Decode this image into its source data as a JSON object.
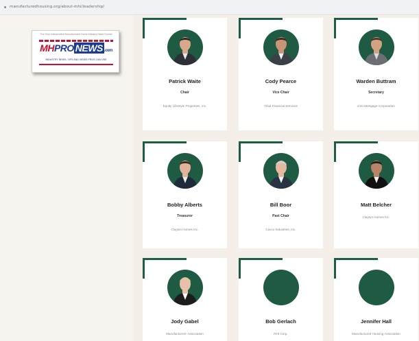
{
  "browser": {
    "url": "manufacturedhousing.org/about-mhi/leadership/"
  },
  "logo": {
    "top_text": "The Only Independent Manufactured Home Industry News Source",
    "brand_mh": "MH",
    "brand_pro": "PRO",
    "brand_news": "NEWS",
    "brand_com": ".com",
    "tagline": "INDUSTRY NEWS, TIPS AND VIEWS PROS CAN USE"
  },
  "cards": [
    {
      "name": "Patrick Waite",
      "role": "Chair",
      "company": "Equity LifeStyle Properties, Inc."
    },
    {
      "name": "Cody Pearce",
      "role": "Vice Chair",
      "company": "Triad Financial Services"
    },
    {
      "name": "Warden Buttram",
      "role": "Secretary",
      "company": "21st Mortgage Corporation"
    },
    {
      "name": "Bobby Alberts",
      "role": "Treasurer",
      "company": "Clayton Homes Inc."
    },
    {
      "name": "Bill Boor",
      "role": "Past Chair",
      "company": "Cavco Industries, Inc."
    },
    {
      "name": "Matt Belcher",
      "role": "",
      "company": "Clayton Homes Inc."
    },
    {
      "name": "Jody Gabel",
      "role": "",
      "company": "Manufacturers' Association"
    },
    {
      "name": "Bob Gerlach",
      "role": "",
      "company": "RHI Corp."
    },
    {
      "name": "Jennifer Hall",
      "role": "",
      "company": "Manufactured Housing Association"
    }
  ]
}
